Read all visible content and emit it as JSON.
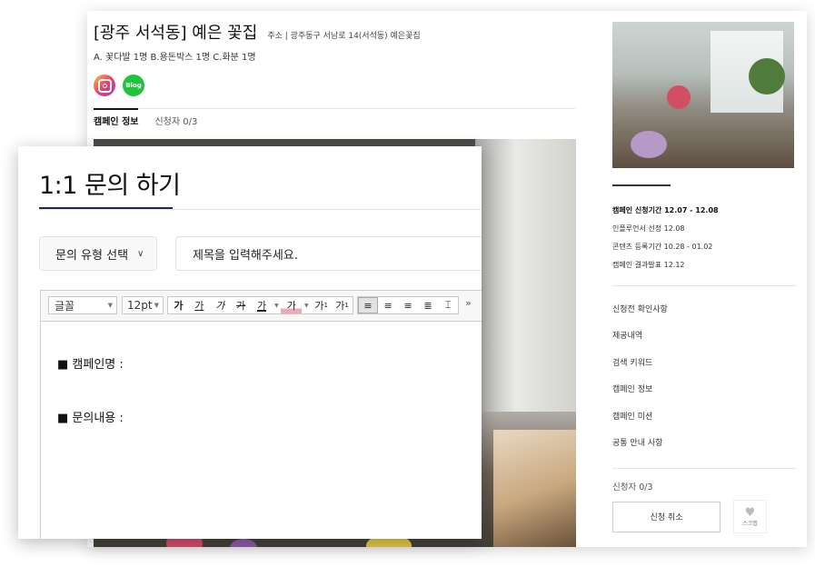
{
  "campaign": {
    "title": "[광주 서석동] 예은 꽃집",
    "address": "주소 | 광주동구 서남로 14(서석동) 예은꽃집",
    "reward": "A. 꽃다발 1명 B.용돈박스 1명 C.화분 1명",
    "sns": {
      "instagram_icon": "instagram-icon",
      "blog_label": "Blog"
    },
    "tabs": [
      {
        "label": "캠페인 정보",
        "active": true
      },
      {
        "label": "신청자 0/3",
        "active": false
      }
    ]
  },
  "sidebar": {
    "period": [
      "캠페인 신청기간 12.07 - 12.08",
      "인플루언서 선정 12.08",
      "콘텐츠 등록기간 10.28 - 01.02",
      "캠페인 결과발표 12.12"
    ],
    "menu": [
      "신청전 확인사항",
      "제공내역",
      "검색 키워드",
      "캠페인 정보",
      "캠페인 미션",
      "공통 안내 사항"
    ],
    "applicants": "신청자 0/3",
    "cancel_button": "신청 취소",
    "scrap_label": "스크랩"
  },
  "modal": {
    "title": "1:1 문의 하기",
    "type_select": {
      "value": "문의 유형 선택",
      "icon": "chevron-down-icon"
    },
    "subject_placeholder": "제목을 입력해주세요.",
    "toolbar": {
      "font": "글꼴",
      "size": "12pt",
      "format_buttons": [
        "가",
        "가",
        "가",
        "가",
        "가",
        "가",
        "가",
        "가"
      ],
      "more": "»"
    },
    "body_lines": [
      "■ 캠페인명 :",
      "■ 문의내용 :"
    ]
  },
  "colors": {
    "accent": "#1e2a4a",
    "blog_green": "#1fc43c"
  }
}
